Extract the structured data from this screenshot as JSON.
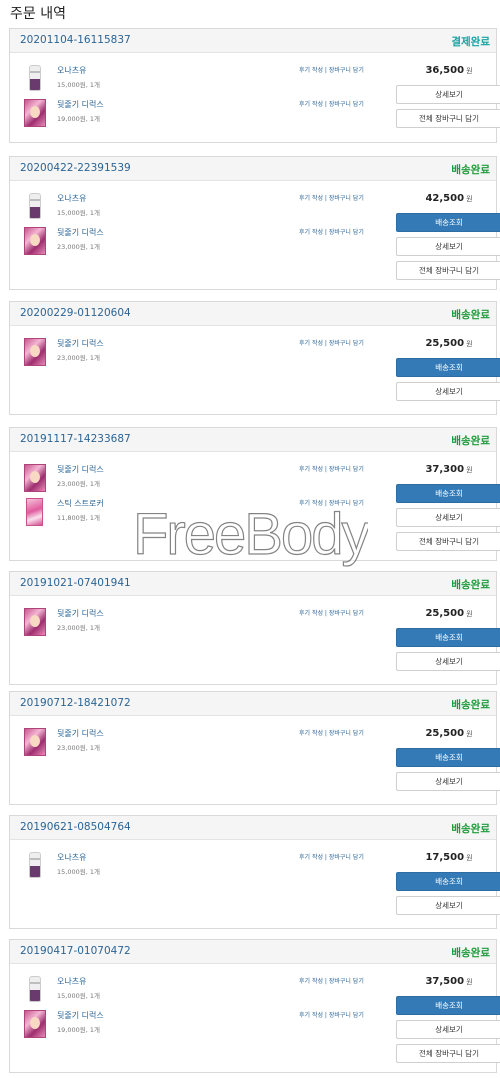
{
  "page_title": "주문 내역",
  "currency": "원",
  "item_links": "후기 작성 | 장바구니 담기",
  "buttons": {
    "track": "배송조회",
    "detail": "상세보기",
    "cart_all": "전체 장바구니 담기"
  },
  "watermark": "FreeBody",
  "orders": [
    {
      "order_no": "20201104-16115837",
      "status": "결제완료",
      "price": "36,500",
      "items": [
        {
          "name": "오나츠유",
          "meta": "15,000원, 1개"
        },
        {
          "name": "뒷줄기 디럭스",
          "meta": "19,000원, 1개"
        }
      ]
    },
    {
      "order_no": "20200422-22391539",
      "status": "배송완료",
      "price": "42,500",
      "items": [
        {
          "name": "오나츠유",
          "meta": "15,000원, 1개"
        },
        {
          "name": "뒷줄기 디럭스",
          "meta": "23,000원, 1개"
        }
      ]
    },
    {
      "order_no": "20200229-01120604",
      "status": "배송완료",
      "price": "25,500",
      "items": [
        {
          "name": "뒷줄기 디럭스",
          "meta": "23,000원, 1개"
        }
      ]
    },
    {
      "order_no": "20191117-14233687",
      "status": "배송완료",
      "price": "37,300",
      "items": [
        {
          "name": "뒷줄기 디럭스",
          "meta": "23,000원, 1개"
        },
        {
          "name": "스틱 스트로커",
          "meta": "11,800원, 1개"
        }
      ]
    },
    {
      "order_no": "20191021-07401941",
      "status": "배송완료",
      "price": "25,500",
      "items": [
        {
          "name": "뒷줄기 디럭스",
          "meta": "23,000원, 1개"
        }
      ]
    },
    {
      "order_no": "20190712-18421072",
      "status": "배송완료",
      "price": "25,500",
      "items": [
        {
          "name": "뒷줄기 디럭스",
          "meta": "23,000원, 1개"
        }
      ]
    },
    {
      "order_no": "20190621-08504764",
      "status": "배송완료",
      "price": "17,500",
      "items": [
        {
          "name": "오나츠유",
          "meta": "15,000원, 1개"
        }
      ]
    },
    {
      "order_no": "20190417-01070472",
      "status": "배송완료",
      "price": "37,500",
      "items": [
        {
          "name": "오나츠유",
          "meta": "15,000원, 1개"
        },
        {
          "name": "뒷줄기 디럭스",
          "meta": "19,000원, 1개"
        }
      ]
    }
  ]
}
